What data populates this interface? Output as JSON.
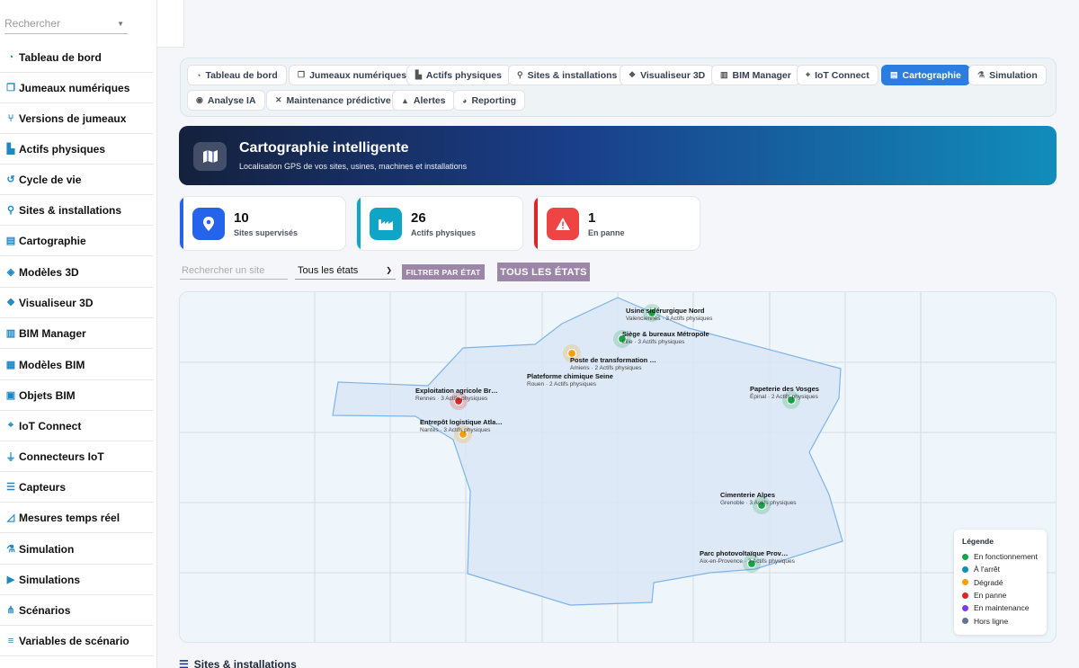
{
  "sidebar": {
    "search_placeholder": "Rechercher",
    "items": [
      {
        "label": "Tableau de bord",
        "icon": "gauge-icon"
      },
      {
        "label": "Jumeaux numériques",
        "icon": "copy-icon"
      },
      {
        "label": "Versions de jumeaux",
        "icon": "branch-icon"
      },
      {
        "label": "Actifs physiques",
        "icon": "factory-icon"
      },
      {
        "label": "Cycle de vie",
        "icon": "history-icon"
      },
      {
        "label": "Sites & installations",
        "icon": "pin-icon"
      },
      {
        "label": "Cartographie",
        "icon": "map-icon"
      },
      {
        "label": "Modèles 3D",
        "icon": "cube-icon"
      },
      {
        "label": "Visualiseur 3D",
        "icon": "cubes-icon"
      },
      {
        "label": "BIM Manager",
        "icon": "building-icon"
      },
      {
        "label": "Modèles BIM",
        "icon": "city-icon"
      },
      {
        "label": "Objets BIM",
        "icon": "grid-icon"
      },
      {
        "label": "IoT Connect",
        "icon": "antenna-icon"
      },
      {
        "label": "Connecteurs IoT",
        "icon": "plug-icon"
      },
      {
        "label": "Capteurs",
        "icon": "sliders-icon"
      },
      {
        "label": "Mesures temps réel",
        "icon": "chart-line-icon"
      },
      {
        "label": "Simulation",
        "icon": "flask-icon"
      },
      {
        "label": "Simulations",
        "icon": "play-circle-icon"
      },
      {
        "label": "Scénarios",
        "icon": "branches-icon"
      },
      {
        "label": "Variables de scénario",
        "icon": "sliders-h-icon"
      }
    ]
  },
  "tabs": [
    {
      "label": "Tableau de bord",
      "icon": "gauge-icon",
      "active": false
    },
    {
      "label": "Jumeaux numériques",
      "icon": "copy-icon",
      "active": false
    },
    {
      "label": "Actifs physiques",
      "icon": "factory-icon",
      "active": false
    },
    {
      "label": "Sites & installations",
      "icon": "pin-icon",
      "active": false
    },
    {
      "label": "Visualiseur 3D",
      "icon": "cubes-icon",
      "active": false
    },
    {
      "label": "BIM Manager",
      "icon": "building-icon",
      "active": false
    },
    {
      "label": "IoT Connect",
      "icon": "antenna-icon",
      "active": false
    },
    {
      "label": "Cartographie",
      "icon": "map-icon",
      "active": true
    },
    {
      "label": "Simulation",
      "icon": "flask-icon",
      "active": false
    },
    {
      "label": "Analyse IA",
      "icon": "brain-icon",
      "active": false
    },
    {
      "label": "Maintenance prédictive",
      "icon": "tools-icon",
      "active": false
    },
    {
      "label": "Alertes",
      "icon": "bell-icon",
      "active": false
    },
    {
      "label": "Reporting",
      "icon": "pie-icon",
      "active": false
    }
  ],
  "hero": {
    "title": "Cartographie intelligente",
    "subtitle": "Localisation GPS de vos sites, usines, machines et installations"
  },
  "stats": [
    {
      "value": "10",
      "label": "Sites supervisés",
      "color": "#2563eb",
      "icon": "pin-icon"
    },
    {
      "value": "26",
      "label": "Actifs physiques",
      "color": "#0ea5c6",
      "icon": "factory-icon"
    },
    {
      "value": "1",
      "label": "En panne",
      "color": "#dc2626",
      "icon": "warning-icon"
    }
  ],
  "filters": {
    "search_placeholder": "Rechercher un site",
    "state_value": "Tous les états",
    "filter_button": "FILTRER PAR ÉTAT",
    "all_states_button": "TOUS LES ÉTATS"
  },
  "map": {
    "sites": [
      {
        "name": "Usine sidérurgique Nord",
        "city": "Valenciennes",
        "assets": "3 Actifs physiques",
        "status": "running"
      },
      {
        "name": "Siège & bureaux Métropole",
        "city": "Lille",
        "assets": "3 Actifs physiques",
        "status": "running"
      },
      {
        "name": "Poste de transformation …",
        "city": "Amiens",
        "assets": "2 Actifs physiques",
        "status": "degraded"
      },
      {
        "name": "Plateforme chimique Seine",
        "city": "Rouen",
        "assets": "2 Actifs physiques",
        "status": "degraded"
      },
      {
        "name": "Exploitation agricole Br…",
        "city": "Rennes",
        "assets": "3 Actifs physiques",
        "status": "down"
      },
      {
        "name": "Entrepôt logistique Atla…",
        "city": "Nantes",
        "assets": "3 Actifs physiques",
        "status": "degraded"
      },
      {
        "name": "Papeterie des Vosges",
        "city": "Épinal",
        "assets": "2 Actifs physiques",
        "status": "running"
      },
      {
        "name": "Cimenterie Alpes",
        "city": "Grenoble",
        "assets": "3 Actifs physiques",
        "status": "running"
      },
      {
        "name": "Parc photovoltaïque Prov…",
        "city": "Aix-en-Provence",
        "assets": "3 Actifs physiques",
        "status": "running"
      }
    ],
    "legend": {
      "title": "Légende",
      "items": [
        {
          "label": "En fonctionnement",
          "color": "#16a34a"
        },
        {
          "label": "À l'arrêt",
          "color": "#0891b2"
        },
        {
          "label": "Dégradé",
          "color": "#f59e0b"
        },
        {
          "label": "En panne",
          "color": "#dc2626"
        },
        {
          "label": "En maintenance",
          "color": "#7c3aed"
        },
        {
          "label": "Hors ligne",
          "color": "#64748b"
        }
      ]
    }
  },
  "section": {
    "title": "Sites & installations"
  }
}
